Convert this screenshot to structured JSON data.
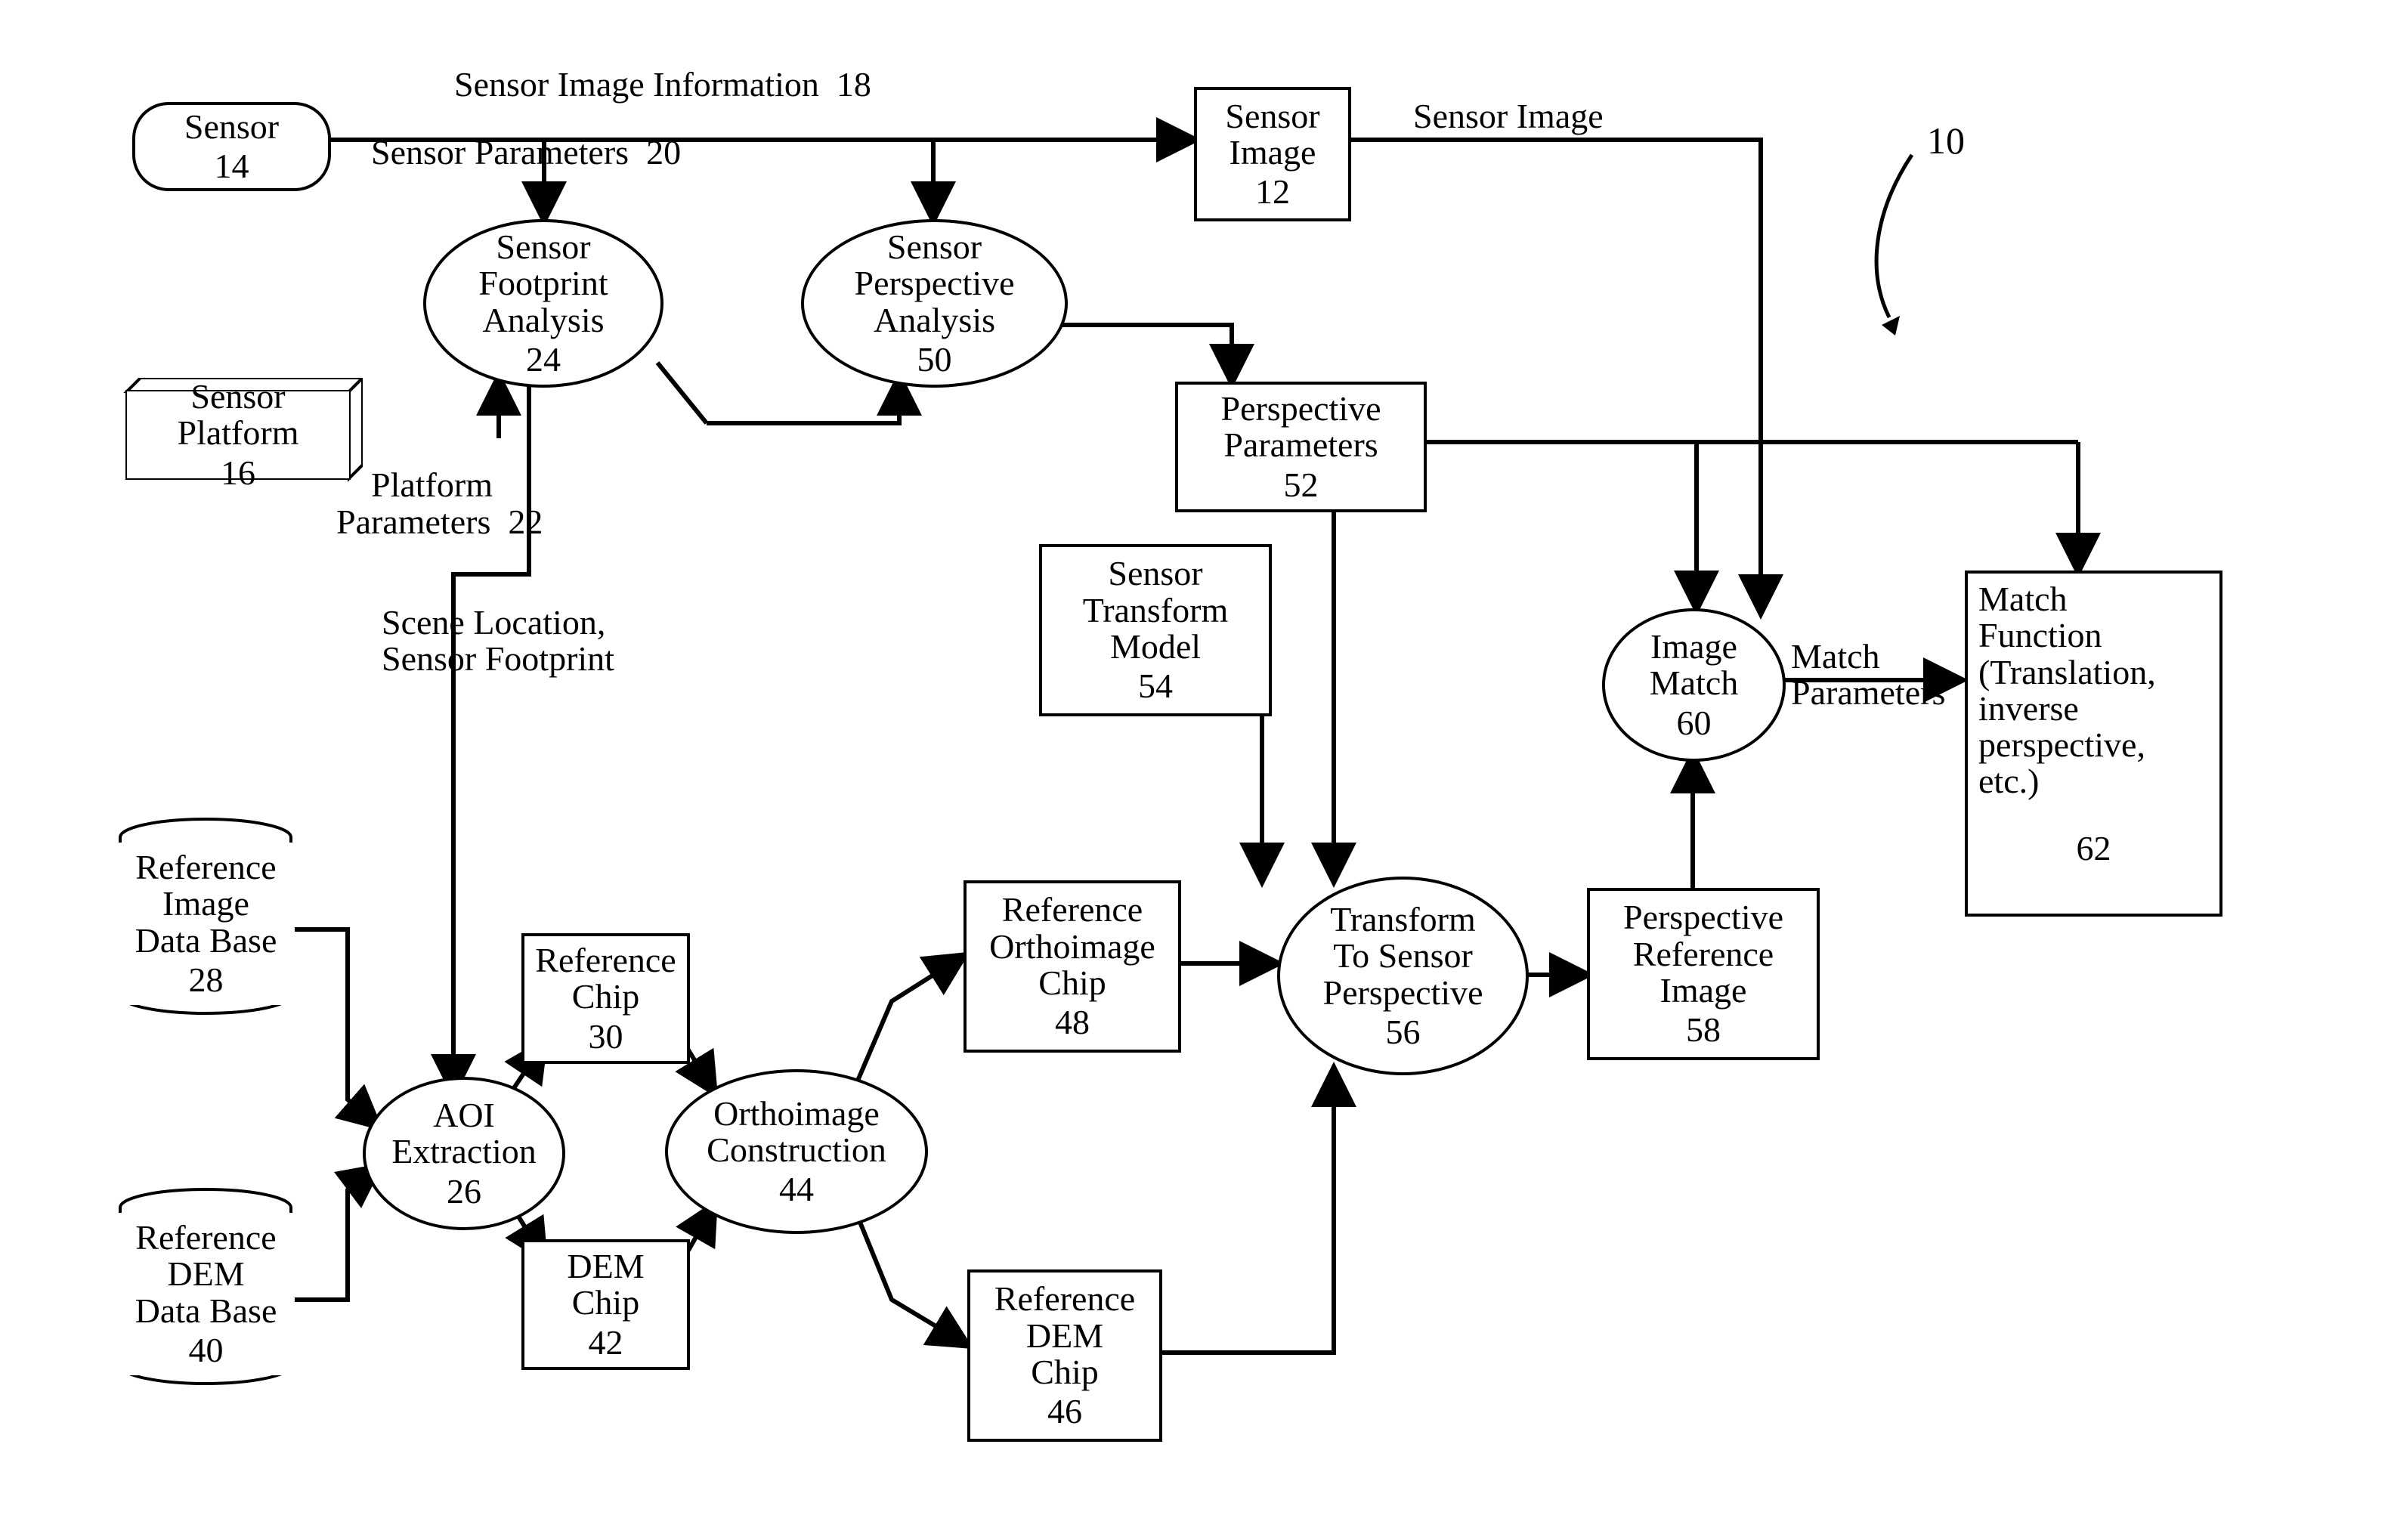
{
  "header": {
    "sensor_image_information": "Sensor Image Information",
    "sensor_image_information_num": "18",
    "sensor_parameters": "Sensor Parameters",
    "sensor_parameters_num": "20",
    "platform_parameters": "Platform\nParameters",
    "platform_parameters_num": "22",
    "scene_location": "Scene Location,\nSensor Footprint",
    "sensor_image_arrow": "Sensor Image",
    "match_parameters": "Match\nParameters",
    "figure_ref": "10"
  },
  "nodes": {
    "sensor": {
      "text": "Sensor",
      "num": "14"
    },
    "sensor_platform": {
      "text": "Sensor Platform",
      "num": "16"
    },
    "sensor_footprint": {
      "text": "Sensor\nFootprint\nAnalysis",
      "num": "24"
    },
    "sensor_perspective": {
      "text": "Sensor\nPerspective\nAnalysis",
      "num": "50"
    },
    "sensor_image": {
      "text": "Sensor\nImage",
      "num": "12"
    },
    "perspective_params": {
      "text": "Perspective\nParameters",
      "num": "52"
    },
    "sensor_transform": {
      "text": "Sensor\nTransform\nModel",
      "num": "54"
    },
    "ref_img_db": {
      "text": "Reference\nImage\nData Base",
      "num": "28"
    },
    "ref_dem_db": {
      "text": "Reference\nDEM\nData Base",
      "num": "40"
    },
    "aoi_extraction": {
      "text": "AOI\nExtraction",
      "num": "26"
    },
    "ref_chip": {
      "text": "Reference\nChip",
      "num": "30"
    },
    "dem_chip": {
      "text": "DEM\nChip",
      "num": "42"
    },
    "orthoimage_constr": {
      "text": "Orthoimage\nConstruction",
      "num": "44"
    },
    "ref_ortho_chip": {
      "text": "Reference\nOrthoimage\nChip",
      "num": "48"
    },
    "ref_dem_chip": {
      "text": "Reference\nDEM\nChip",
      "num": "46"
    },
    "transform_to_sp": {
      "text": "Transform\nTo Sensor\nPerspective",
      "num": "56"
    },
    "persp_ref_image": {
      "text": "Perspective\nReference\nImage",
      "num": "58"
    },
    "image_match": {
      "text": "Image\nMatch",
      "num": "60"
    },
    "match_function": {
      "text": "Match\nFunction\n(Translation,\ninverse\nperspective,\netc.)",
      "num": "62"
    }
  }
}
